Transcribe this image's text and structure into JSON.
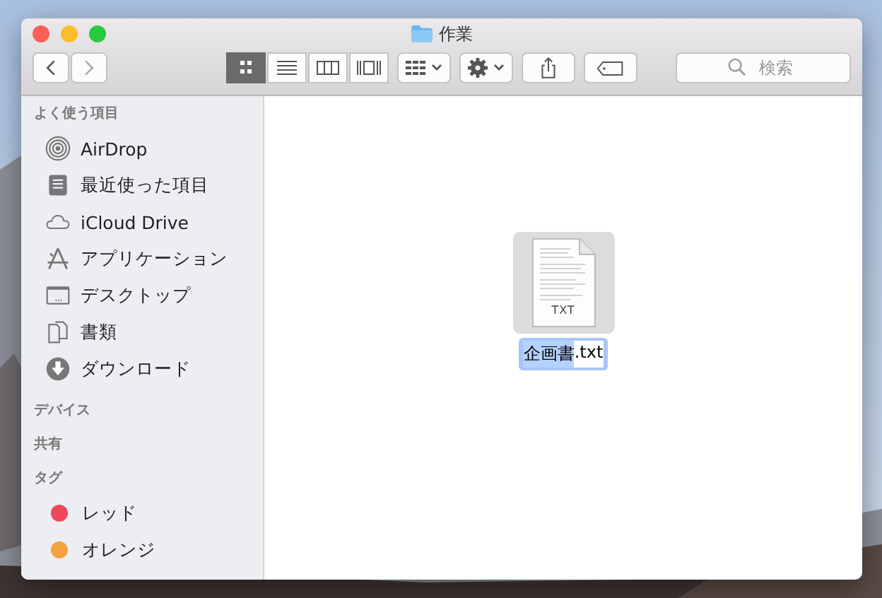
{
  "window": {
    "title": "作業"
  },
  "toolbar": {
    "view_modes": [
      {
        "kind": "icon",
        "selected": true
      },
      {
        "kind": "list",
        "selected": false
      },
      {
        "kind": "column",
        "selected": false
      },
      {
        "kind": "cover",
        "selected": false
      }
    ],
    "search": {
      "placeholder": "検索"
    }
  },
  "sidebar": {
    "sections": [
      {
        "title": "よく使う項目",
        "items": [
          {
            "label": "AirDrop",
            "kind": "airdrop"
          },
          {
            "label": "最近使った項目",
            "kind": "recents"
          },
          {
            "label": "iCloud Drive",
            "kind": "cloud"
          },
          {
            "label": "アプリケーション",
            "kind": "apps"
          },
          {
            "label": "デスクトップ",
            "kind": "desktop"
          },
          {
            "label": "書類",
            "kind": "documents"
          },
          {
            "label": "ダウンロード",
            "kind": "downloads"
          }
        ]
      },
      {
        "title": "デバイス"
      },
      {
        "title": "共有"
      },
      {
        "title": "タグ",
        "items": [
          {
            "label": "レッド",
            "kind": "tag",
            "color": "#f0475a"
          },
          {
            "label": "オレンジ",
            "kind": "tag",
            "color": "#f4a23f"
          }
        ]
      }
    ]
  },
  "files": [
    {
      "kind": "txt",
      "badge": "TXT",
      "selected": true,
      "name_parts": [
        {
          "text": "企画書",
          "selected": true
        },
        {
          "text": ".txt",
          "selected": false
        }
      ]
    }
  ]
}
